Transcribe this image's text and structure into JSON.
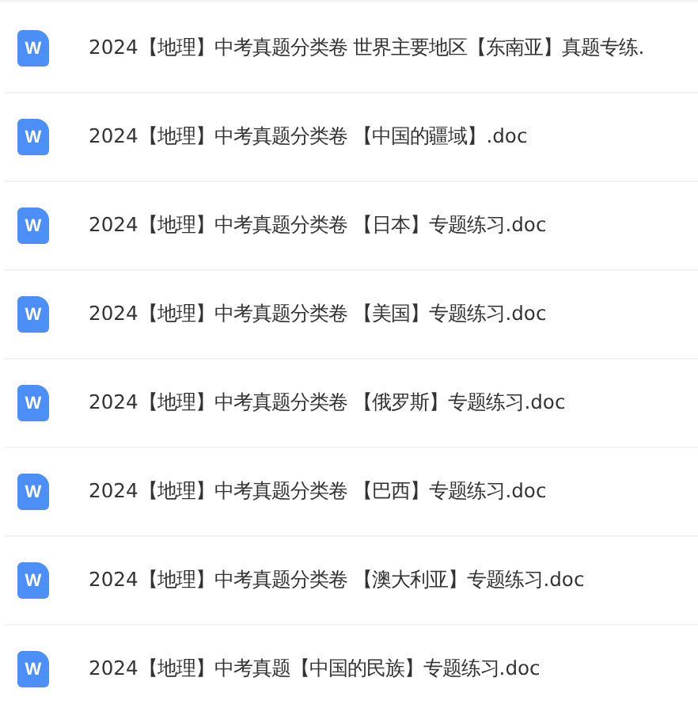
{
  "files": [
    {
      "icon_letter": "W",
      "name": "2024【地理】中考真题分类卷 世界主要地区【东南亚】真题专练."
    },
    {
      "icon_letter": "W",
      "name": "2024【地理】中考真题分类卷 【中国的疆域】.doc"
    },
    {
      "icon_letter": "W",
      "name": "2024【地理】中考真题分类卷 【日本】专题练习.doc"
    },
    {
      "icon_letter": "W",
      "name": "2024【地理】中考真题分类卷 【美国】专题练习.doc"
    },
    {
      "icon_letter": "W",
      "name": "2024【地理】中考真题分类卷 【俄罗斯】专题练习.doc"
    },
    {
      "icon_letter": "W",
      "name": "2024【地理】中考真题分类卷 【巴西】专题练习.doc"
    },
    {
      "icon_letter": "W",
      "name": "2024【地理】中考真题分类卷 【澳大利亚】专题练习.doc"
    },
    {
      "icon_letter": "W",
      "name": "2024【地理】中考真题【中国的民族】专题练习.doc"
    }
  ]
}
